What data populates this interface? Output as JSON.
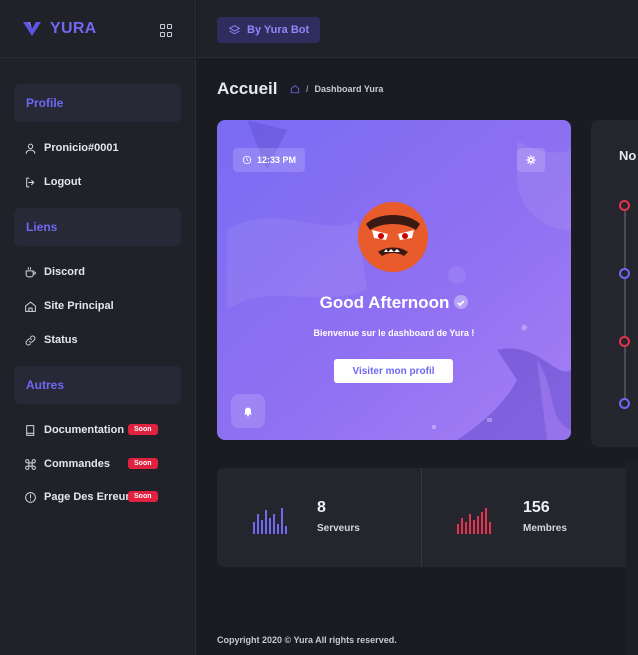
{
  "brand": {
    "name": "YURA"
  },
  "sidebar": {
    "sections": [
      {
        "label": "Profile"
      },
      {
        "label": "Liens"
      },
      {
        "label": "Autres"
      }
    ],
    "items": [
      {
        "label": "Pronicio#0001",
        "icon": "user-icon"
      },
      {
        "label": "Logout",
        "icon": "logout-icon"
      },
      {
        "label": "Discord",
        "icon": "cup-icon"
      },
      {
        "label": "Site Principal",
        "icon": "home-icon"
      },
      {
        "label": "Status",
        "icon": "link-icon"
      },
      {
        "label": "Documentation",
        "icon": "book-icon",
        "badge": "Soon"
      },
      {
        "label": "Commandes",
        "icon": "command-icon",
        "badge": "Soon"
      },
      {
        "label": "Page Des Erreurs",
        "icon": "alert-icon",
        "badge": "Soon"
      }
    ]
  },
  "topbar": {
    "button_label": "By Yura Bot"
  },
  "page": {
    "title": "Accueil",
    "breadcrumb": "Dashboard Yura"
  },
  "hero": {
    "time": "12:33 PM",
    "greeting": "Good Afternoon",
    "welcome": "Bienvenue sur le dashboard de Yura !",
    "button_label": "Visiter mon profil"
  },
  "side_card": {
    "title_partial": "No"
  },
  "stats": [
    {
      "value": "8",
      "label": "Serveurs",
      "color": "#6e68f2"
    },
    {
      "value": "156",
      "label": "Membres",
      "color": "#e5334f"
    }
  ],
  "footer": {
    "text": "Copyright 2020 © Yura All rights reserved."
  },
  "colors": {
    "accent": "#6e68f2",
    "danger": "#e0213f",
    "bg": "#1b1c22",
    "panel": "#24252d"
  }
}
